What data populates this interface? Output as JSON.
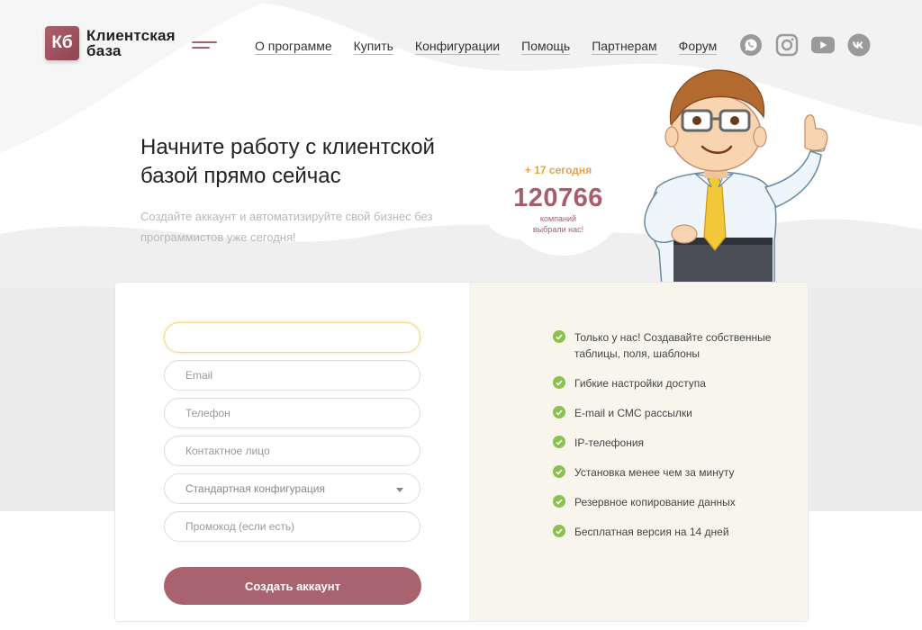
{
  "logo": {
    "badge": "Кб",
    "line1": "Клиентская",
    "line2": "база"
  },
  "nav": [
    "О программе",
    "Купить",
    "Конфигурации",
    "Помощь",
    "Партнерам",
    "Форум"
  ],
  "social": [
    "whatsapp-icon",
    "instagram-icon",
    "youtube-icon",
    "vk-icon"
  ],
  "hero": {
    "title": "Начните работу с клиентской базой прямо сейчас",
    "subtitle": "Создайте аккаунт и автоматизируйте свой бизнес без программистов уже сегодня!"
  },
  "counter": {
    "today": "+ 17 сегодня",
    "count": "120766",
    "caption_line1": "компаний",
    "caption_line2": "выбрали нас!"
  },
  "form": {
    "name_value": "",
    "email_placeholder": "Email",
    "phone_placeholder": "Телефон",
    "contact_placeholder": "Контактное лицо",
    "config_value": "Стандартная конфигурация",
    "promo_placeholder": "Промокод (если есть)",
    "submit_label": "Создать аккаунт"
  },
  "features": [
    "Только у нас! Создавайте собственные таблицы, поля, шаблоны",
    "Гибкие настройки доступа",
    "E-mail и СМС рассылки",
    "IP-телефония",
    "Установка менее чем за минуту",
    "Резервное копирование данных",
    "Бесплатная версия на 14 дней"
  ],
  "colors": {
    "brand": "#a8636f",
    "accent_yellow": "#e0a24a",
    "check_green": "#8cc152",
    "panel_bg": "#f8f6ec",
    "wave_bg": "#ededed"
  }
}
